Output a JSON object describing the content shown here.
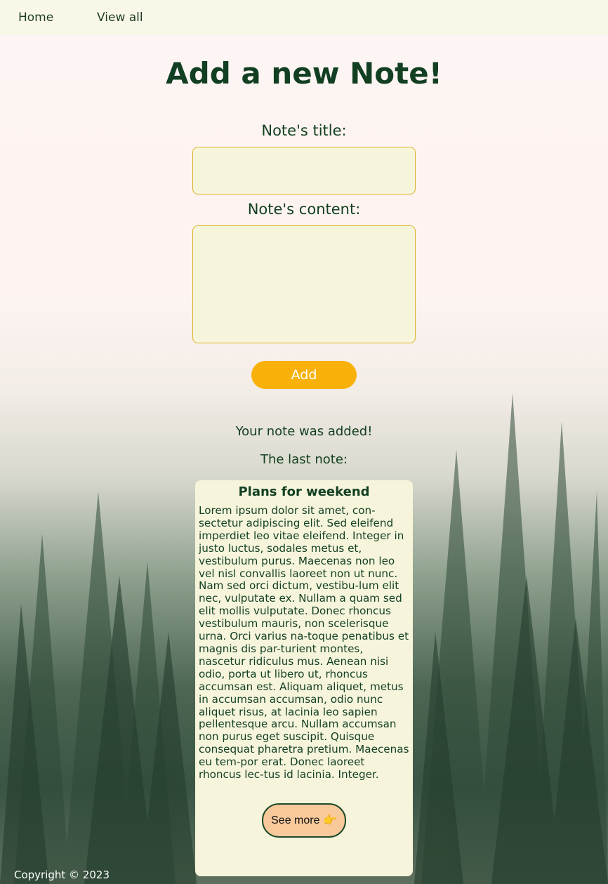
{
  "nav": {
    "items": [
      {
        "label": "Home"
      },
      {
        "label": "View all"
      }
    ]
  },
  "main": {
    "title": "Add a new Note!",
    "title_label": "Note's title:",
    "content_label": "Note's content:",
    "title_value": "",
    "content_value": "",
    "add_button": "Add",
    "status": "Your note was added!",
    "last_note_label": "The last note:"
  },
  "last_note": {
    "title": "Plans for weekend",
    "body": "Lorem ipsum dolor sit amet, con-sectetur adipiscing elit. Sed eleifend imperdiet leo vitae eleifend. Integer in justo luctus, sodales metus et, vestibulum purus. Maecenas non leo vel nisl convallis laoreet non ut nunc. Nam sed orci dictum, vestibu-lum elit nec, vulputate ex. Nullam a quam sed elit mollis vulputate. Donec rhoncus vestibulum mauris, non scelerisque urna. Orci varius na-toque penatibus et magnis dis par-turient montes, nascetur ridiculus mus. Aenean nisi odio, porta ut libero ut, rhoncus accumsan est. Aliquam aliquet, metus in accumsan accumsan, odio nunc aliquet risus, at lacinia leo sapien pellentesque arcu. Nullam accumsan non purus eget suscipit. Quisque consequat pharetra pretium. Maecenas eu tem-por erat. Donec laoreet rhoncus lec-tus id lacinia. Integer.",
    "see_more": "See more 👉"
  },
  "footer": {
    "copyright": "Copyright © 2023"
  },
  "colors": {
    "accent": "#f8b108",
    "text": "#14401f",
    "input_bg": "#f6f5dc",
    "input_border": "#e0b324",
    "nav_bg": "#f8f7e8",
    "see_more_bg": "#f7c99b"
  },
  "icons": {
    "see_more": "pointing-hand-icon"
  }
}
